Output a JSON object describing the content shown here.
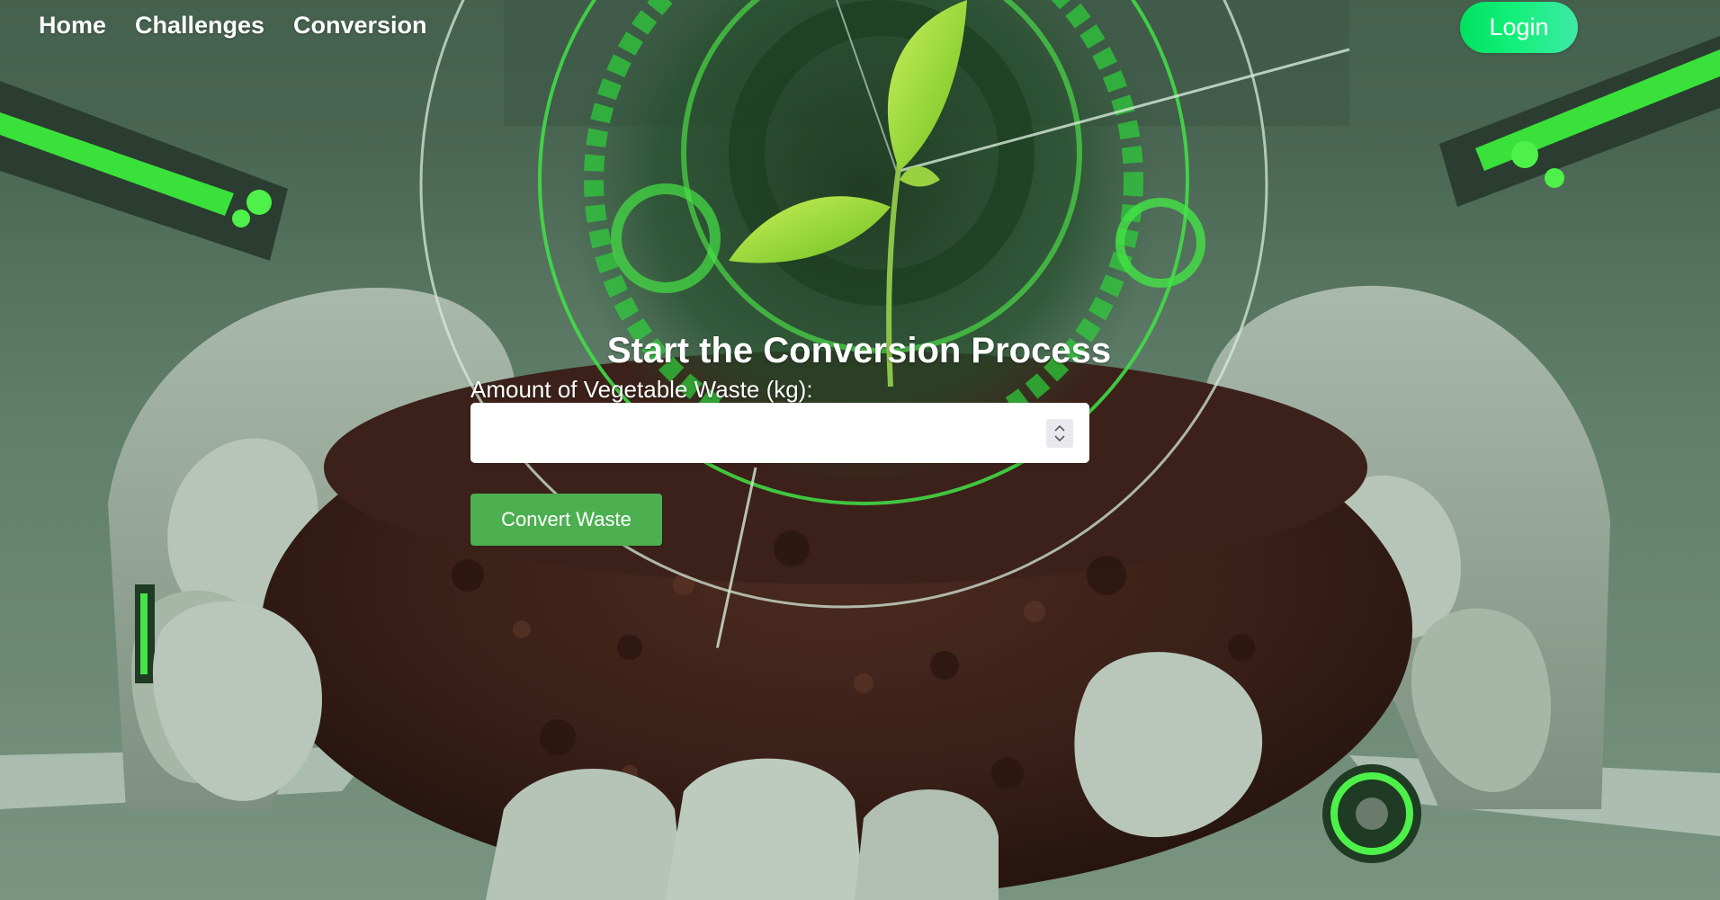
{
  "nav": {
    "links": [
      {
        "label": "Home"
      },
      {
        "label": "Challenges"
      },
      {
        "label": "Conversion"
      }
    ],
    "login_label": "Login"
  },
  "form": {
    "title": "Start the Conversion Process",
    "label": "Amount of Vegetable Waste (kg):",
    "input_value": "",
    "input_placeholder": "",
    "submit_label": "Convert Waste"
  },
  "icons": {
    "spinner": "number-spinner-icon"
  },
  "colors": {
    "login_gradient_start": "#00e15f",
    "login_gradient_end": "#3fe9a6",
    "convert_button": "#4caf50",
    "text": "#ffffff"
  }
}
